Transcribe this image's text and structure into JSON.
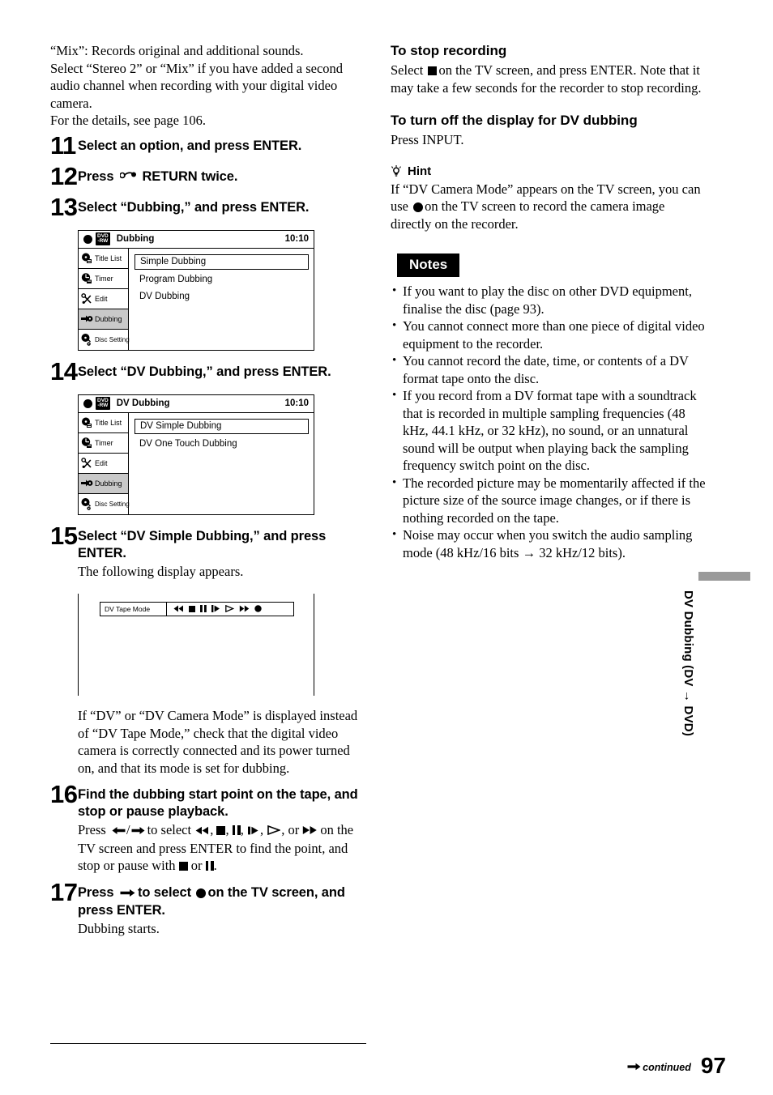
{
  "page_number": "97",
  "continued_label": "continued",
  "side_tab": {
    "label": "DV Dubbing (DV → DVD)"
  },
  "left_column": {
    "intro": {
      "line1": "“Mix”: Records original and additional sounds.",
      "line2": "Select “Stereo 2” or “Mix” if you have added a second audio channel when recording with your digital video camera.",
      "line3": "For the details, see page 106."
    },
    "steps": [
      {
        "number": "11",
        "title": "Select an option, and press ENTER."
      },
      {
        "number": "12",
        "title_before": "Press",
        "title_after": "RETURN twice.",
        "icon": "return-arrow-icon"
      },
      {
        "number": "13",
        "title": "Select “Dubbing,” and press ENTER."
      },
      {
        "number": "14",
        "title": "Select “DV Dubbing,” and press ENTER."
      },
      {
        "number": "15",
        "title": "Select “DV Simple Dubbing,” and press ENTER.",
        "desc": "The following display appears."
      },
      {
        "number": "16",
        "title": "Find the dubbing start point on the tape, and stop or pause playback."
      },
      {
        "number": "17",
        "title": "press ENTER.",
        "desc": "Dubbing starts."
      }
    ],
    "step16_desc": {
      "p1": "Press",
      "p2": "to select",
      "p3": "on the TV screen and press ENTER to find the point, and stop or pause with",
      "p4": "or",
      "p5": "."
    },
    "step17_title": {
      "p1": "Press",
      "p2": "to select",
      "p3": "on the TV screen, and press ENTER."
    },
    "after_tape_note": "If “DV” or “DV Camera Mode” is displayed instead of “DV Tape Mode,” check that the digital video camera is correctly connected and its power turned on, and that its mode is set for dubbing.",
    "osd_dubbing": {
      "disc_badge_top": "DVD",
      "disc_badge_bottom": "-RW",
      "title": "Dubbing",
      "clock": "10:10",
      "sidebar": [
        {
          "label": "Title List",
          "icon": "title-list-icon",
          "selected": false
        },
        {
          "label": "Timer",
          "icon": "timer-icon",
          "selected": false
        },
        {
          "label": "Edit",
          "icon": "edit-scissors-icon",
          "selected": false
        },
        {
          "label": "Dubbing",
          "icon": "dubbing-icon",
          "selected": true
        },
        {
          "label": "Disc Setting",
          "icon": "disc-setting-icon",
          "selected": false
        }
      ],
      "options": [
        {
          "label": "Simple Dubbing",
          "highlighted": true
        },
        {
          "label": "Program Dubbing",
          "highlighted": false
        },
        {
          "label": "DV Dubbing",
          "highlighted": false
        }
      ]
    },
    "osd_dv_dubbing": {
      "disc_badge_top": "DVD",
      "disc_badge_bottom": "-RW",
      "title": "DV Dubbing",
      "clock": "10:10",
      "sidebar": [
        {
          "label": "Title List",
          "icon": "title-list-icon",
          "selected": false
        },
        {
          "label": "Timer",
          "icon": "timer-icon",
          "selected": false
        },
        {
          "label": "Edit",
          "icon": "edit-scissors-icon",
          "selected": false
        },
        {
          "label": "Dubbing",
          "icon": "dubbing-icon",
          "selected": true
        },
        {
          "label": "Disc Setting",
          "icon": "disc-setting-icon",
          "selected": false
        }
      ],
      "options": [
        {
          "label": "DV Simple Dubbing",
          "highlighted": true
        },
        {
          "label": "DV One Touch Dubbing",
          "highlighted": false
        }
      ]
    },
    "tape_mode": {
      "label": "DV Tape Mode",
      "icons": [
        "rewind-icon",
        "stop-icon",
        "pause-icon",
        "frame-advance-icon",
        "play-icon",
        "fast-forward-icon",
        "record-icon"
      ]
    }
  },
  "right_column": {
    "stop_recording": {
      "heading": "To stop recording",
      "text_before": "Select",
      "text_after": "on the TV screen, and press ENTER. Note that it may take a few seconds for the recorder to stop recording."
    },
    "turn_off_display": {
      "heading": "To turn off the display for DV dubbing",
      "text": "Press INPUT."
    },
    "hint": {
      "heading": "Hint",
      "text_before": "If “DV Camera Mode” appears on the TV screen, you can use",
      "text_after": "on the TV screen to record the camera image directly on the recorder."
    },
    "notes": {
      "heading": "Notes",
      "items": [
        "If you want to play the disc on other DVD equipment, finalise the disc (page 93).",
        "You cannot connect more than one piece of digital video equipment to the recorder.",
        "You cannot record the date, time, or contents of a DV format tape onto the disc.",
        "If you record from a DV format tape with a soundtrack that is recorded in multiple sampling frequencies (48 kHz, 44.1 kHz, or 32 kHz), no sound, or an unnatural sound will be output when playing back the sampling frequency switch point on the disc.",
        "The recorded picture may be momentarily affected if the picture size of the source image changes, or if there is nothing recorded on the tape.",
        "Noise may occur when you switch the audio sampling mode (48 kHz/16 bits → 32 kHz/12 bits)."
      ]
    }
  }
}
